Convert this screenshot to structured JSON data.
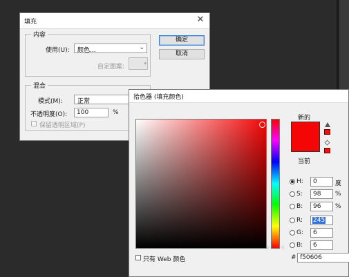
{
  "fill_dialog": {
    "title": "填充",
    "content_group": {
      "legend": "内容",
      "use_label": "使用(U):",
      "use_value": "颜色...",
      "custom_pattern_label": "自定图案:"
    },
    "blend_group": {
      "legend": "混合",
      "mode_label": "模式(M):",
      "mode_value": "正常",
      "opacity_label": "不透明度(O):",
      "opacity_value": "100",
      "opacity_unit": "%",
      "preserve_transparency_label": "保留透明区域(P)"
    },
    "ok_label": "确定",
    "cancel_label": "取消"
  },
  "color_picker": {
    "title": "拾色器 (填充颜色)",
    "new_label": "新的",
    "current_label": "当前",
    "new_color": "#f50606",
    "current_color": "#f50606",
    "hsb": {
      "h_label": "H:",
      "h_value": "0",
      "h_unit": "度",
      "s_label": "S:",
      "s_value": "98",
      "s_unit": "%",
      "b_label": "B:",
      "b_value": "96",
      "b_unit": "%"
    },
    "rgb": {
      "r_label": "R:",
      "r_value": "245",
      "g_label": "G:",
      "g_value": "6",
      "b_label": "B:",
      "b_value": "6"
    },
    "hex_symbol": "#",
    "hex_value": "f50606",
    "web_only_label": "只有 Web 颜色"
  }
}
